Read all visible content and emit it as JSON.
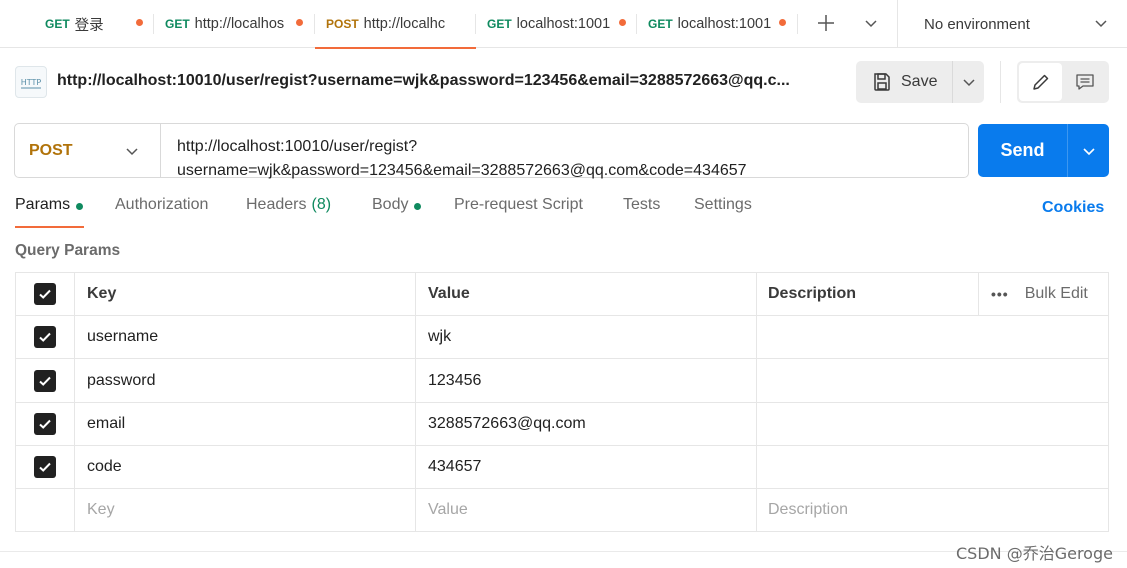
{
  "tabs": [
    {
      "method": "GET",
      "name": "登录",
      "unsaved": true,
      "active": false
    },
    {
      "method": "GET",
      "name": "http://localhos",
      "unsaved": true,
      "active": false
    },
    {
      "method": "POST",
      "name": "http://localhc",
      "unsaved": false,
      "active": true
    },
    {
      "method": "GET",
      "name": "localhost:1001",
      "unsaved": true,
      "active": false
    },
    {
      "method": "GET",
      "name": "localhost:1001",
      "unsaved": true,
      "active": false
    }
  ],
  "environment": {
    "selected": "No environment"
  },
  "request": {
    "icon_label": "HTTP",
    "title": "http://localhost:10010/user/regist?username=wjk&password=123456&email=3288572663@qq.c...",
    "save_label": "Save",
    "method": "POST",
    "url_line1": "http://localhost:10010/user/regist?",
    "url_line2": "username=wjk&password=123456&email=3288572663@qq.com&code=434657",
    "send_label": "Send"
  },
  "request_tabs": [
    {
      "label": "Params",
      "dot": true,
      "active": true
    },
    {
      "label": "Authorization"
    },
    {
      "label": "Headers",
      "count": "(8)"
    },
    {
      "label": "Body",
      "dot": true
    },
    {
      "label": "Pre-request Script"
    },
    {
      "label": "Tests"
    },
    {
      "label": "Settings"
    }
  ],
  "cookies_label": "Cookies",
  "query_params": {
    "section_label": "Query Params",
    "headers": {
      "key": "Key",
      "value": "Value",
      "description": "Description",
      "bulk_edit": "Bulk Edit",
      "more": "•••"
    },
    "rows": [
      {
        "key": "username",
        "value": "wjk",
        "checked": true
      },
      {
        "key": "password",
        "value": "123456",
        "checked": true
      },
      {
        "key": "email",
        "value": "3288572663@qq.com",
        "checked": true
      },
      {
        "key": "code",
        "value": "434657",
        "checked": true
      }
    ],
    "placeholder": {
      "key": "Key",
      "value": "Value",
      "description": "Description"
    }
  },
  "watermark": "CSDN @乔治Geroge",
  "colors": {
    "accent": "#f26b3a",
    "send": "#097bed",
    "get": "#0f8a5f",
    "post": "#b1730a"
  }
}
